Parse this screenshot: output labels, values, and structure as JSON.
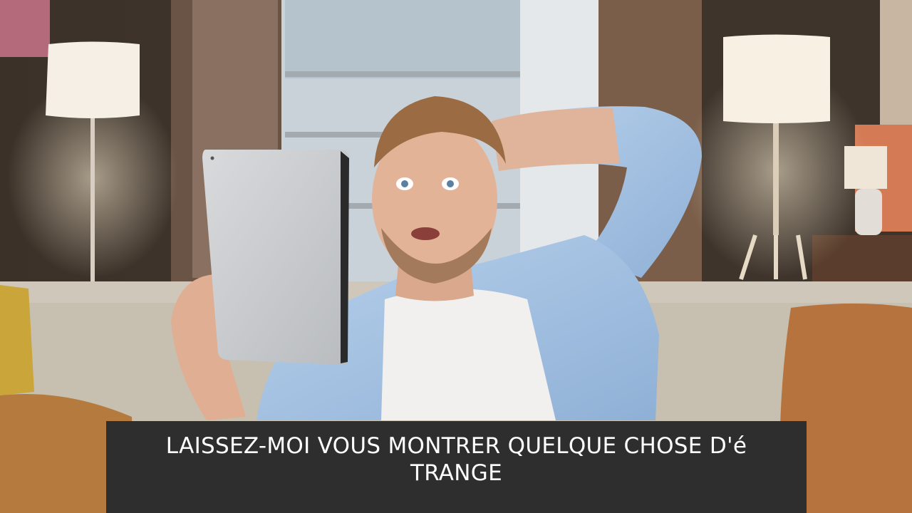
{
  "video": {
    "subtitle_lines": [
      "LAISSEZ-MOI VOUS MONTRER QUELQUE CHOSE D'é",
      "TRANGE"
    ]
  },
  "colors": {
    "subtitle_background": "#2e2e2e",
    "subtitle_text": "#ffffff",
    "shirt": "#a9c6e6",
    "sofa": "#c7bfb0"
  }
}
